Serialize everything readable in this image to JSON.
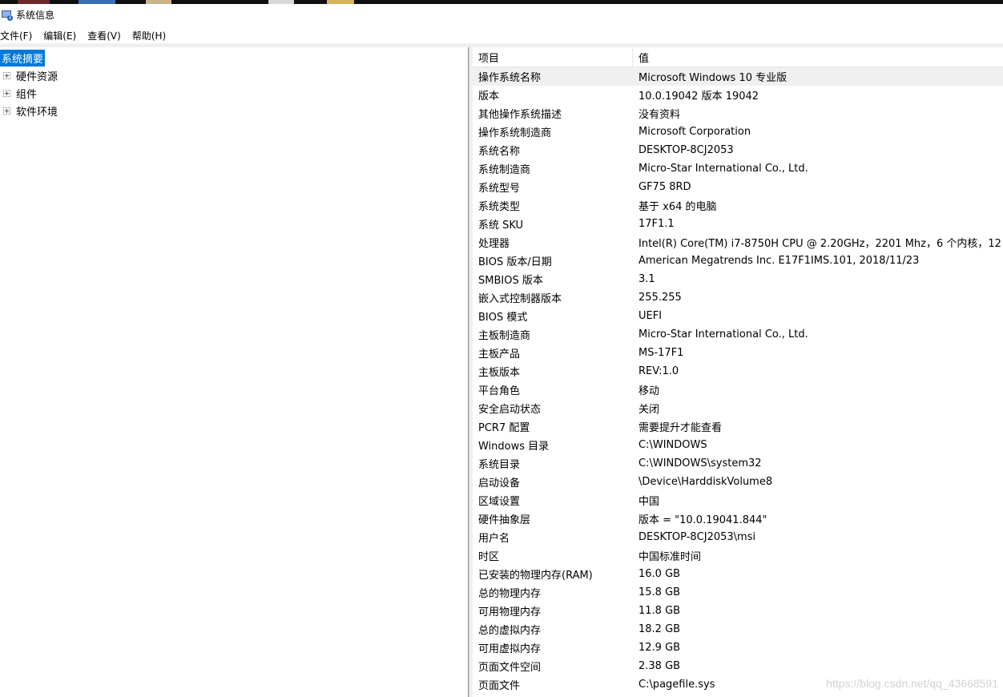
{
  "window": {
    "title": "系统信息"
  },
  "menu": [
    "文件(F)",
    "编辑(E)",
    "查看(V)",
    "帮助(H)"
  ],
  "tree": [
    {
      "label": "系统摘要",
      "selected": true,
      "expandable": false
    },
    {
      "label": "硬件资源",
      "selected": false,
      "expandable": true
    },
    {
      "label": "组件",
      "selected": false,
      "expandable": true
    },
    {
      "label": "软件环境",
      "selected": false,
      "expandable": true
    }
  ],
  "details": {
    "headers": {
      "item": "项目",
      "value": "值"
    },
    "rows": [
      {
        "item": "操作系统名称",
        "value": "Microsoft Windows 10 专业版"
      },
      {
        "item": "版本",
        "value": "10.0.19042 版本 19042"
      },
      {
        "item": "其他操作系统描述",
        "value": "没有资料"
      },
      {
        "item": "操作系统制造商",
        "value": "Microsoft Corporation"
      },
      {
        "item": "系统名称",
        "value": "DESKTOP-8CJ2053"
      },
      {
        "item": "系统制造商",
        "value": "Micro-Star International Co., Ltd."
      },
      {
        "item": "系统型号",
        "value": "GF75 8RD"
      },
      {
        "item": "系统类型",
        "value": "基于 x64 的电脑"
      },
      {
        "item": "系统 SKU",
        "value": "17F1.1"
      },
      {
        "item": "处理器",
        "value": "Intel(R) Core(TM) i7-8750H CPU @ 2.20GHz，2201 Mhz，6 个内核，12 ..."
      },
      {
        "item": "BIOS 版本/日期",
        "value": "American Megatrends Inc. E17F1IMS.101, 2018/11/23"
      },
      {
        "item": "SMBIOS 版本",
        "value": "3.1"
      },
      {
        "item": "嵌入式控制器版本",
        "value": "255.255"
      },
      {
        "item": "BIOS 模式",
        "value": "UEFI"
      },
      {
        "item": "主板制造商",
        "value": "Micro-Star International Co., Ltd."
      },
      {
        "item": "主板产品",
        "value": "MS-17F1"
      },
      {
        "item": "主板版本",
        "value": "REV:1.0"
      },
      {
        "item": "平台角色",
        "value": "移动"
      },
      {
        "item": "安全启动状态",
        "value": "关闭"
      },
      {
        "item": "PCR7 配置",
        "value": "需要提升才能查看"
      },
      {
        "item": "Windows 目录",
        "value": "C:\\WINDOWS"
      },
      {
        "item": "系统目录",
        "value": "C:\\WINDOWS\\system32"
      },
      {
        "item": "启动设备",
        "value": "\\Device\\HarddiskVolume8"
      },
      {
        "item": "区域设置",
        "value": "中国"
      },
      {
        "item": "硬件抽象层",
        "value": "版本 = \"10.0.19041.844\""
      },
      {
        "item": "用户名",
        "value": "DESKTOP-8CJ2053\\msi"
      },
      {
        "item": "时区",
        "value": "中国标准时间"
      },
      {
        "item": "已安装的物理内存(RAM)",
        "value": "16.0 GB"
      },
      {
        "item": "总的物理内存",
        "value": "15.8 GB"
      },
      {
        "item": "可用物理内存",
        "value": "11.8 GB"
      },
      {
        "item": "总的虚拟内存",
        "value": "18.2 GB"
      },
      {
        "item": "可用虚拟内存",
        "value": "12.9 GB"
      },
      {
        "item": "页面文件空间",
        "value": "2.38 GB"
      },
      {
        "item": "页面文件",
        "value": "C:\\pagefile.sys"
      }
    ]
  },
  "watermark": "https://blog.csdn.net/qq_43668591",
  "colors": {
    "selection": "#0078d7",
    "row_highlight": "#f0f0f0"
  }
}
